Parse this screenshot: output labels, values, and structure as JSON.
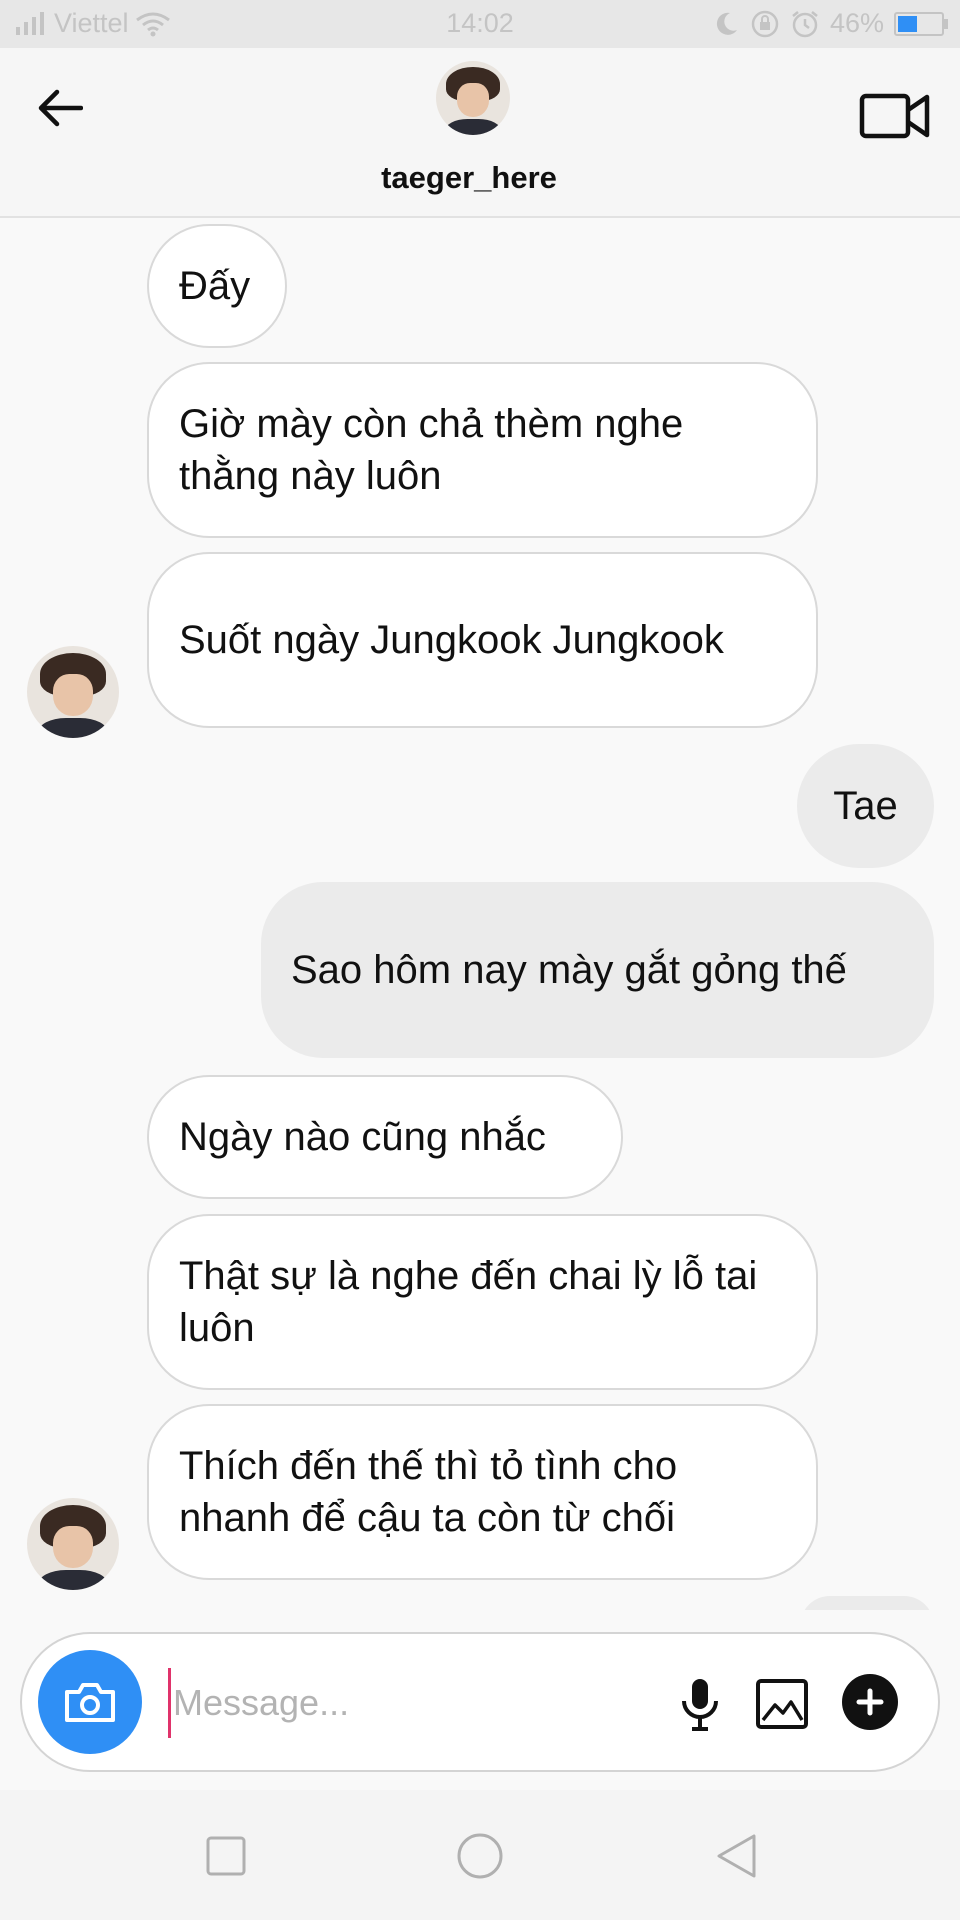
{
  "status_bar": {
    "carrier": "Viettel",
    "time": "14:02",
    "battery_percent": "46%",
    "battery_level": 0.46,
    "icons": [
      "signal-icon",
      "wifi-icon",
      "moon-icon",
      "rotation-lock-icon",
      "alarm-icon",
      "battery-icon"
    ]
  },
  "header": {
    "username": "taeger_here",
    "back_icon": "arrow-left-icon",
    "video_icon": "video-camera-icon"
  },
  "messages": [
    {
      "from": "them",
      "text": "Đấy"
    },
    {
      "from": "them",
      "text": "Giờ mày còn chả thèm nghe thằng này luôn"
    },
    {
      "from": "them",
      "text": "Suốt ngày Jungkook Jungkook"
    },
    {
      "from": "me",
      "text": "Tae"
    },
    {
      "from": "me",
      "text": "Sao hôm nay mày gắt gỏng thế"
    },
    {
      "from": "them",
      "text": "Ngày nào cũng nhắc"
    },
    {
      "from": "them",
      "text": "Thật sự là nghe đến chai lỳ lỗ tai luôn"
    },
    {
      "from": "them",
      "text": "Thích đến thế thì tỏ tình cho nhanh để cậu ta còn từ chối"
    }
  ],
  "composer": {
    "placeholder": "Message...",
    "value": "",
    "icons": [
      "camera-icon",
      "microphone-icon",
      "gallery-icon",
      "plus-icon"
    ]
  },
  "navbar": {
    "icons": [
      "recent-apps-icon",
      "home-icon",
      "back-triangle-icon"
    ]
  },
  "colors": {
    "accent": "#2f8ff5",
    "incoming_bubble": "#ffffff",
    "outgoing_bubble": "#ebebeb",
    "cursor": "#e0336b"
  }
}
